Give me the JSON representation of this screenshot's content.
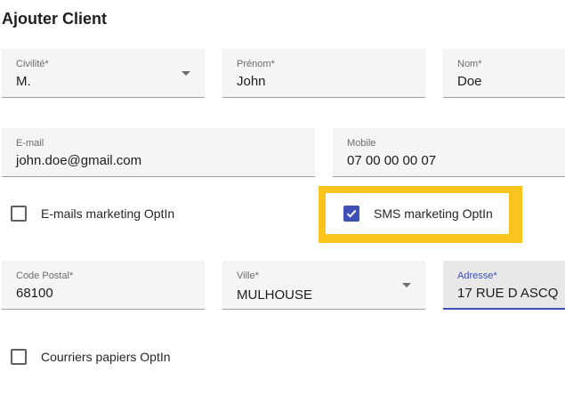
{
  "page": {
    "title": "Ajouter Client"
  },
  "form": {
    "civilite": {
      "label": "Civilité*",
      "value": "M."
    },
    "prenom": {
      "label": "Prénom*",
      "value": "John"
    },
    "nom": {
      "label": "Nom*",
      "value": "Doe"
    },
    "email": {
      "label": "E-mail",
      "value": "john.doe@gmail.com"
    },
    "mobile": {
      "label": "Mobile",
      "value": "07 00 00 00 07"
    },
    "email_optin": {
      "label": "E-mails marketing OptIn",
      "checked": false
    },
    "sms_optin": {
      "label": "SMS marketing OptIn",
      "checked": true
    },
    "code_postal": {
      "label": "Code Postal*",
      "value": "68100"
    },
    "ville": {
      "label": "Ville*",
      "value": "MULHOUSE"
    },
    "adresse": {
      "label": "Adresse*",
      "value": "17 RUE D ASCQ"
    },
    "courriers_optin": {
      "label": "Courriers papiers OptIn",
      "checked": false
    }
  },
  "colors": {
    "accent": "#3f51b5",
    "highlight": "#f9c41e",
    "field_bg": "#f5f5f5"
  }
}
